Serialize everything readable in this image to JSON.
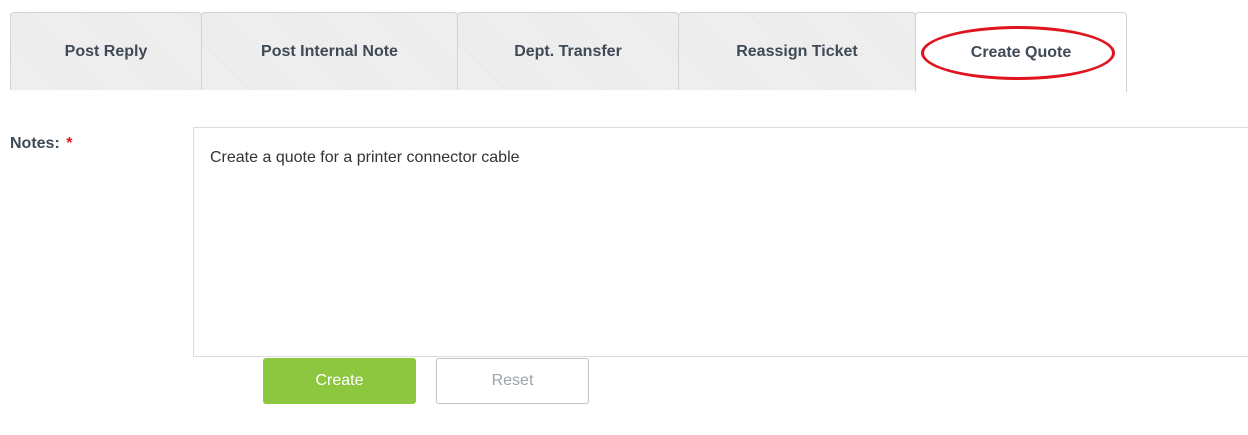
{
  "tabs": [
    {
      "label": "Post Reply",
      "active": false
    },
    {
      "label": "Post Internal Note",
      "active": false
    },
    {
      "label": "Dept. Transfer",
      "active": false
    },
    {
      "label": "Reassign Ticket",
      "active": false
    },
    {
      "label": "Create Quote",
      "active": true
    }
  ],
  "form": {
    "notes_label": "Notes:",
    "required_mark": "*",
    "notes_value": "Create a quote for a printer connector cable"
  },
  "buttons": {
    "create_label": "Create",
    "reset_label": "Reset"
  },
  "colors": {
    "highlight": "#e0141e",
    "create_button": "#8dc63f",
    "required": "#e0141e"
  }
}
